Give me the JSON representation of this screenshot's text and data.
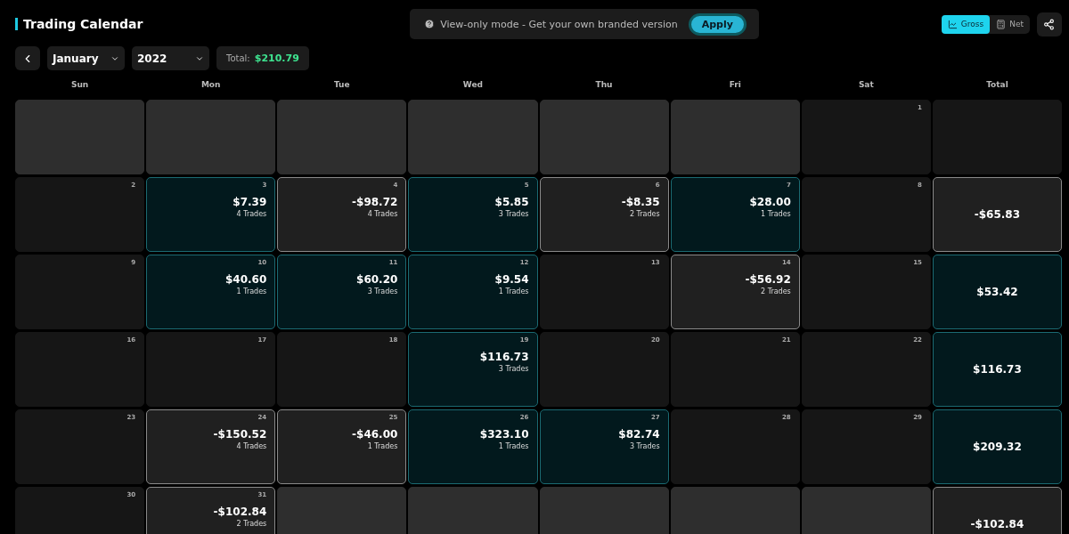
{
  "header": {
    "title": "Trading Calendar"
  },
  "banner": {
    "text": "View-only mode - Get your own branded version",
    "button": "Apply"
  },
  "view_toggle": [
    {
      "label": "Gross",
      "selected": true
    },
    {
      "label": "Net",
      "selected": false
    }
  ],
  "controls": {
    "month": "January",
    "year": "2022",
    "total_label": "Total:",
    "total_value": "$210.79"
  },
  "columns": [
    "Sun",
    "Mon",
    "Tue",
    "Wed",
    "Thu",
    "Fri",
    "Sat",
    "Total"
  ],
  "weeks": [
    {
      "days": [
        {
          "kind": "outside"
        },
        {
          "kind": "outside"
        },
        {
          "kind": "outside"
        },
        {
          "kind": "outside"
        },
        {
          "kind": "outside"
        },
        {
          "kind": "outside"
        },
        {
          "kind": "empty",
          "day": "1"
        }
      ],
      "total": {
        "kind": "empty"
      }
    },
    {
      "days": [
        {
          "kind": "empty",
          "day": "2"
        },
        {
          "kind": "win",
          "day": "3",
          "amount": "$7.39",
          "trades": "4 Trades"
        },
        {
          "kind": "loss",
          "day": "4",
          "amount": "-$98.72",
          "trades": "4 Trades"
        },
        {
          "kind": "win",
          "day": "5",
          "amount": "$5.85",
          "trades": "3 Trades"
        },
        {
          "kind": "loss",
          "day": "6",
          "amount": "-$8.35",
          "trades": "2 Trades"
        },
        {
          "kind": "win",
          "day": "7",
          "amount": "$28.00",
          "trades": "1 Trades"
        },
        {
          "kind": "empty",
          "day": "8"
        }
      ],
      "total": {
        "kind": "loss",
        "amount": "-$65.83"
      }
    },
    {
      "days": [
        {
          "kind": "empty",
          "day": "9"
        },
        {
          "kind": "win",
          "day": "10",
          "amount": "$40.60",
          "trades": "1 Trades"
        },
        {
          "kind": "win",
          "day": "11",
          "amount": "$60.20",
          "trades": "3 Trades"
        },
        {
          "kind": "win",
          "day": "12",
          "amount": "$9.54",
          "trades": "1 Trades"
        },
        {
          "kind": "empty",
          "day": "13"
        },
        {
          "kind": "loss",
          "day": "14",
          "amount": "-$56.92",
          "trades": "2 Trades"
        },
        {
          "kind": "empty",
          "day": "15"
        }
      ],
      "total": {
        "kind": "win",
        "amount": "$53.42"
      }
    },
    {
      "days": [
        {
          "kind": "empty",
          "day": "16"
        },
        {
          "kind": "empty",
          "day": "17"
        },
        {
          "kind": "empty",
          "day": "18"
        },
        {
          "kind": "win",
          "day": "19",
          "amount": "$116.73",
          "trades": "3 Trades"
        },
        {
          "kind": "empty",
          "day": "20"
        },
        {
          "kind": "empty",
          "day": "21"
        },
        {
          "kind": "empty",
          "day": "22"
        }
      ],
      "total": {
        "kind": "win",
        "amount": "$116.73"
      }
    },
    {
      "days": [
        {
          "kind": "empty",
          "day": "23"
        },
        {
          "kind": "loss",
          "day": "24",
          "amount": "-$150.52",
          "trades": "4 Trades"
        },
        {
          "kind": "loss",
          "day": "25",
          "amount": "-$46.00",
          "trades": "1 Trades"
        },
        {
          "kind": "win",
          "day": "26",
          "amount": "$323.10",
          "trades": "1 Trades"
        },
        {
          "kind": "win",
          "day": "27",
          "amount": "$82.74",
          "trades": "3 Trades"
        },
        {
          "kind": "empty",
          "day": "28"
        },
        {
          "kind": "empty",
          "day": "29"
        }
      ],
      "total": {
        "kind": "win",
        "amount": "$209.32"
      }
    },
    {
      "days": [
        {
          "kind": "empty",
          "day": "30"
        },
        {
          "kind": "loss",
          "day": "31",
          "amount": "-$102.84",
          "trades": "2 Trades"
        },
        {
          "kind": "outside"
        },
        {
          "kind": "outside"
        },
        {
          "kind": "outside"
        },
        {
          "kind": "outside"
        },
        {
          "kind": "outside"
        }
      ],
      "total": {
        "kind": "loss",
        "amount": "-$102.84"
      }
    }
  ]
}
